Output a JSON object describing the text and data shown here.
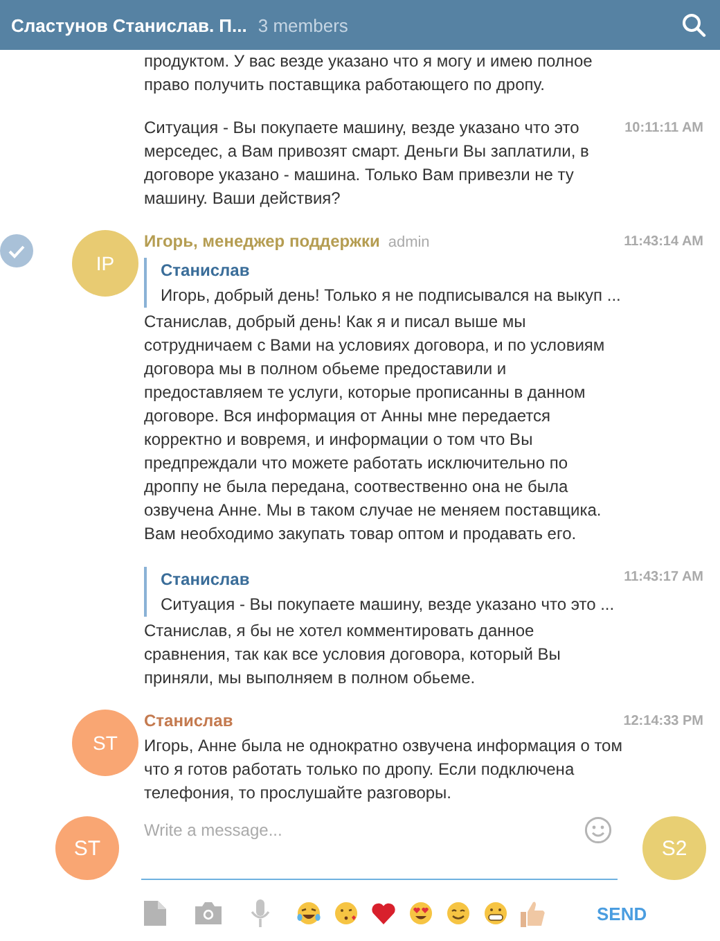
{
  "header": {
    "title": "Сластунов Станислав. П...",
    "subtitle": "3 members"
  },
  "messages": [
    {
      "selected": false,
      "text": "продуктом. У вас везде указано что я могу и имею полное право получить поставщика работающего по дропу."
    },
    {
      "selected": false,
      "time": "10:11:11 AM",
      "text": "Ситуация - Вы покупаете машину, везде указано что это мерседес, а Вам привозят смарт. Деньги Вы заплатили, в договоре указано - машина. Только Вам привезли не ту машину. Ваши действия?"
    },
    {
      "selected": true,
      "avatar": {
        "initials": "IP",
        "color": "#e8cb72"
      },
      "author": {
        "name": "Игорь, менеджер поддержки",
        "color": "#b59d52",
        "role": "admin"
      },
      "time": "11:43:14 AM",
      "reply": {
        "author": "Станислав",
        "text": "Игорь, добрый день! Только я не подписывался на выкуп ..."
      },
      "text": "Станислав, добрый день! Как я и писал выше мы сотрудничаем с Вами на условиях договора, и по условиям договора мы в полном обьеме предоставили и предоставляем те услуги, которые прописанны в данном договоре. Вся информация от Анны мне передается корректно и вовремя, и информации о том что Вы предпреждали что можете работать исключительно по дроппу не была передана, соотвественно она не была озвучена Анне. Мы в таком случае не меняем поставщика. Вам необходимо закупать товар оптом и продавать его."
    },
    {
      "selected": false,
      "time": "11:43:17 AM",
      "reply": {
        "author": "Станислав",
        "text": "Ситуация - Вы покупаете машину, везде указано что это ..."
      },
      "text": "Станислав, я бы не хотел комментировать данное сравнения, так как все условия договора, который Вы приняли, мы выполняем в полном обьеме."
    },
    {
      "selected": false,
      "avatar": {
        "initials": "ST",
        "color": "#f9a673"
      },
      "author": {
        "name": "Станислав",
        "color": "#c47a4f"
      },
      "time": "12:14:33 PM",
      "text": "Игорь, Анне была не однократно озвучена информация о том что я готов работать только по дропу. Если подключена телефония, то прослушайте разговоры."
    }
  ],
  "composer": {
    "my_avatar": {
      "initials": "ST",
      "color": "#f9a673"
    },
    "placeholder": "Write a message...",
    "peer_avatar": {
      "initials": "S2",
      "color": "#e8cf73"
    },
    "send": "SEND"
  }
}
